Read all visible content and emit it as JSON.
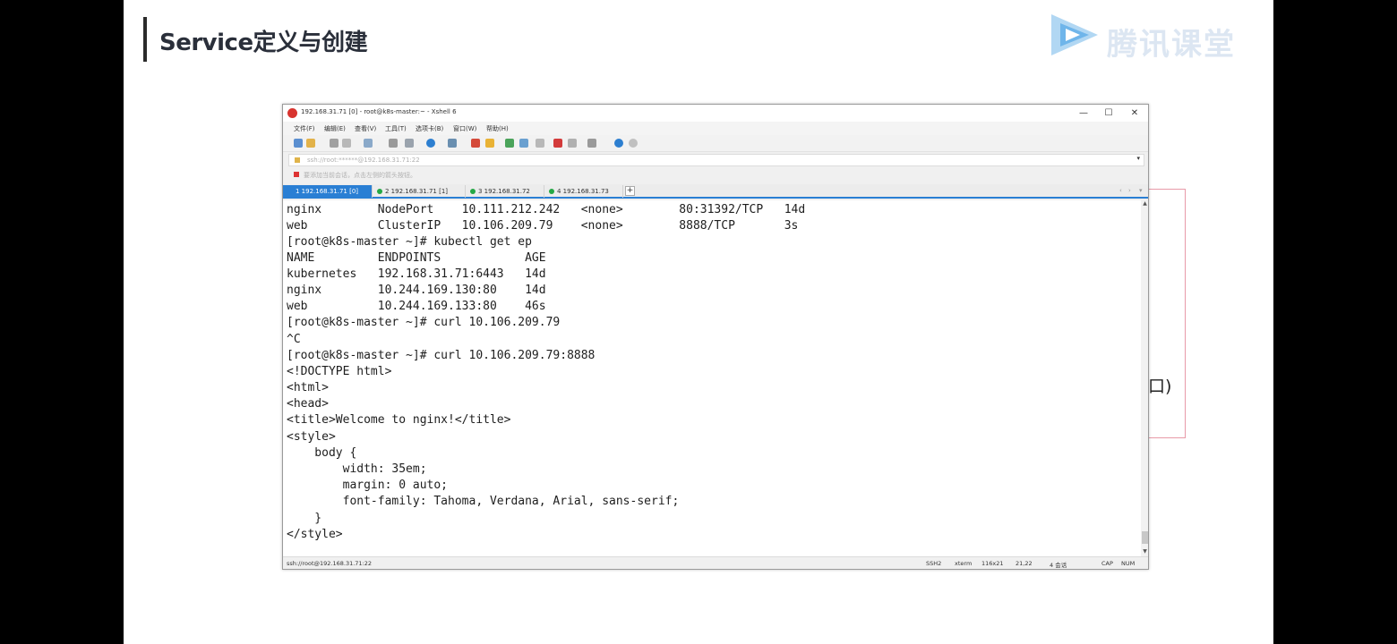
{
  "slide": {
    "title": "Service定义与创建",
    "logo_text": "腾讯课堂",
    "behind_text": "口)"
  },
  "window": {
    "title": "192.168.31.71 [0] - root@k8s-master:~ - Xshell 6",
    "controls": {
      "minimize": "—",
      "maximize": "☐",
      "close": "✕"
    }
  },
  "menu": [
    "文件(F)",
    "编辑(E)",
    "查看(V)",
    "工具(T)",
    "选项卡(B)",
    "窗口(W)",
    "帮助(H)"
  ],
  "address": {
    "value": "ssh://root:******@192.168.31.71:22",
    "hint": "要添加当前会话，点击左侧的箭头按钮。"
  },
  "tabs": [
    {
      "label": "1 192.168.31.71 [0]",
      "active": true
    },
    {
      "label": "2 192.168.31.71 [1]",
      "active": false
    },
    {
      "label": "3 192.168.31.72",
      "active": false
    },
    {
      "label": "4 192.168.31.73",
      "active": false
    }
  ],
  "terminal": {
    "lines": [
      "nginx        NodePort    10.111.212.242   <none>        80:31392/TCP   14d",
      "web          ClusterIP   10.106.209.79    <none>        8888/TCP       3s",
      "[root@k8s-master ~]# kubectl get ep",
      "NAME         ENDPOINTS            AGE",
      "kubernetes   192.168.31.71:6443   14d",
      "nginx        10.244.169.130:80    14d",
      "web          10.244.169.133:80    46s",
      "[root@k8s-master ~]# curl 10.106.209.79",
      "^C",
      "[root@k8s-master ~]# curl 10.106.209.79:8888",
      "<!DOCTYPE html>",
      "<html>",
      "<head>",
      "<title>Welcome to nginx!</title>",
      "<style>",
      "    body {",
      "        width: 35em;",
      "        margin: 0 auto;",
      "        font-family: Tahoma, Verdana, Arial, sans-serif;",
      "    }",
      "</style>"
    ]
  },
  "status": {
    "connection": "ssh://root@192.168.31.71:22",
    "protocol": "SSH2",
    "term": "xterm",
    "size": "116x21",
    "cursor": "21,22",
    "sessions": "4 会话",
    "cap": "CAP",
    "num": "NUM"
  },
  "colors": {
    "accent": "#2a7fd4",
    "slide_bar": "#2b2b2b",
    "red_box": "#e89aa8"
  }
}
